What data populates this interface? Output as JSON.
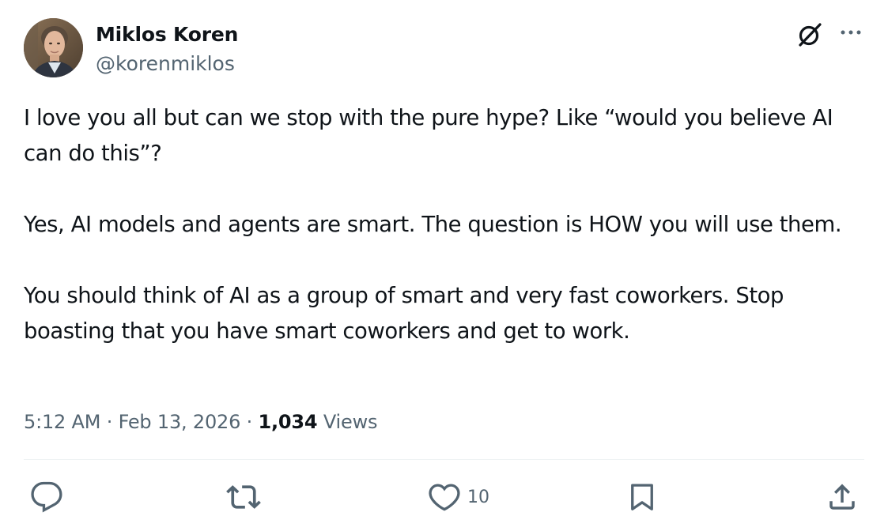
{
  "author": {
    "display_name": "Miklos Koren",
    "handle": "@korenmiklos"
  },
  "tweet": {
    "paragraphs": [
      "I love you all but can we stop with the pure hype? Like “would you believe AI can do this”?",
      "Yes, AI models and agents are smart. The question is HOW you will use them.",
      "You should think of AI as a group of smart and very fast coworkers. Stop boasting that you have smart coworkers and get to work."
    ],
    "time": "5:12 AM",
    "date": "Feb 13, 2026",
    "separator": "·",
    "views_count": "1,034",
    "views_label": "Views"
  },
  "actions": {
    "like_count": "10"
  },
  "icons": {
    "avatar": "avatar-photo",
    "grok": "grok-icon",
    "more": "more-options-icon",
    "reply": "reply-icon",
    "retweet": "retweet-icon",
    "like": "heart-icon",
    "bookmark": "bookmark-icon",
    "share": "share-icon"
  },
  "colors": {
    "text_primary": "#0f1419",
    "text_secondary": "#536471",
    "divider": "#eff3f4",
    "background": "#ffffff"
  }
}
